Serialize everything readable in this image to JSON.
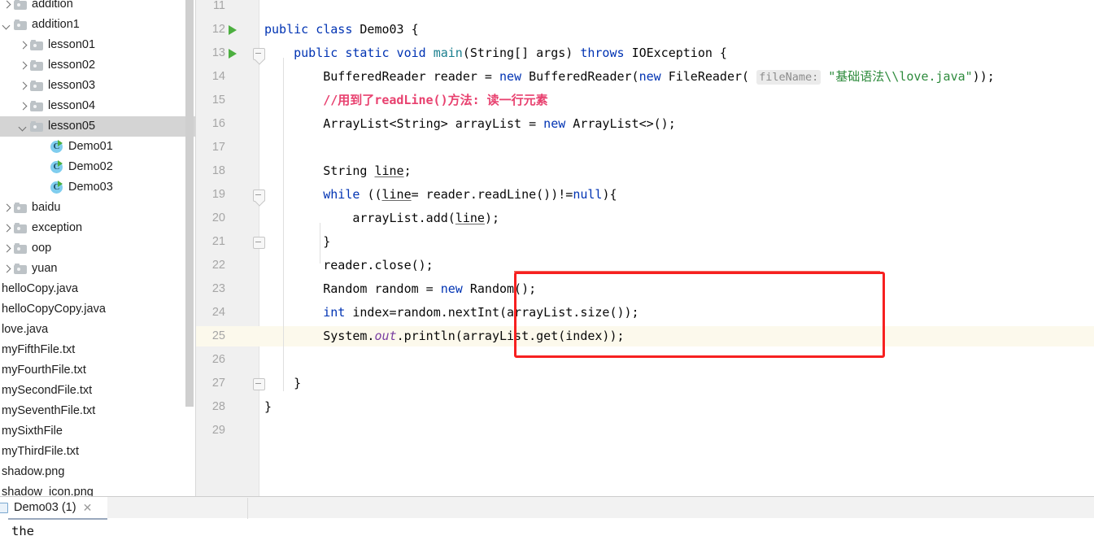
{
  "sidebar": {
    "tree": [
      {
        "label": "addition",
        "type": "folder",
        "arrow": "closed",
        "indent": 0,
        "selected": false,
        "clipped": true
      },
      {
        "label": "addition1",
        "type": "folder",
        "arrow": "open",
        "indent": 0,
        "selected": false
      },
      {
        "label": "lesson01",
        "type": "folder",
        "arrow": "closed",
        "indent": 1,
        "selected": false
      },
      {
        "label": "lesson02",
        "type": "folder",
        "arrow": "closed",
        "indent": 1,
        "selected": false
      },
      {
        "label": "lesson03",
        "type": "folder",
        "arrow": "closed",
        "indent": 1,
        "selected": false
      },
      {
        "label": "lesson04",
        "type": "folder",
        "arrow": "closed",
        "indent": 1,
        "selected": false
      },
      {
        "label": "lesson05",
        "type": "folder",
        "arrow": "open",
        "indent": 1,
        "selected": true
      },
      {
        "label": "Demo01",
        "type": "class",
        "indent": 2,
        "selected": false
      },
      {
        "label": "Demo02",
        "type": "class",
        "indent": 2,
        "selected": false
      },
      {
        "label": "Demo03",
        "type": "class",
        "indent": 2,
        "selected": false
      },
      {
        "label": "baidu",
        "type": "folder",
        "arrow": "closed",
        "indent": 0,
        "selected": false
      },
      {
        "label": "exception",
        "type": "folder",
        "arrow": "closed",
        "indent": 0,
        "selected": false
      },
      {
        "label": "oop",
        "type": "folder",
        "arrow": "closed",
        "indent": 0,
        "selected": false
      },
      {
        "label": "yuan",
        "type": "folder",
        "arrow": "closed",
        "indent": 0,
        "selected": false
      },
      {
        "label": "helloCopy.java",
        "type": "file",
        "indent": 0,
        "selected": false
      },
      {
        "label": "helloCopyCopy.java",
        "type": "file",
        "indent": 0,
        "selected": false
      },
      {
        "label": "love.java",
        "type": "file",
        "indent": 0,
        "selected": false
      },
      {
        "label": "myFifthFile.txt",
        "type": "file",
        "indent": 0,
        "selected": false
      },
      {
        "label": "myFourthFile.txt",
        "type": "file",
        "indent": 0,
        "selected": false
      },
      {
        "label": "mySecondFile.txt",
        "type": "file",
        "indent": 0,
        "selected": false
      },
      {
        "label": "mySeventhFile.txt",
        "type": "file",
        "indent": 0,
        "selected": false
      },
      {
        "label": "mySixthFile",
        "type": "file",
        "indent": 0,
        "selected": false
      },
      {
        "label": "myThirdFile.txt",
        "type": "file",
        "indent": 0,
        "selected": false
      },
      {
        "label": "shadow.png",
        "type": "file",
        "indent": 0,
        "selected": false
      },
      {
        "label": "shadow_icon.png",
        "type": "file",
        "indent": 0,
        "selected": false,
        "clipped": true
      }
    ]
  },
  "editor": {
    "first_line_number": 11,
    "current_line": 25,
    "lines": [
      {
        "n": 11,
        "run": false,
        "fold": null,
        "tokens": []
      },
      {
        "n": 12,
        "run": true,
        "fold": null,
        "tokens": [
          {
            "t": "public ",
            "c": "kw"
          },
          {
            "t": "class ",
            "c": "kw"
          },
          {
            "t": "Demo03 {",
            "c": ""
          }
        ],
        "indent": 0
      },
      {
        "n": 13,
        "run": true,
        "fold": "tip",
        "tokens": [
          {
            "t": "    ",
            "c": ""
          },
          {
            "t": "public static void ",
            "c": "kw"
          },
          {
            "t": "main",
            "c": "meth"
          },
          {
            "t": "(String[] args) ",
            "c": ""
          },
          {
            "t": "throws ",
            "c": "kw"
          },
          {
            "t": "IOException {",
            "c": ""
          }
        ],
        "indent": 1
      },
      {
        "n": 14,
        "run": false,
        "fold": null,
        "tokens": [
          {
            "t": "        BufferedReader reader = ",
            "c": ""
          },
          {
            "t": "new ",
            "c": "kw"
          },
          {
            "t": "BufferedReader(",
            "c": ""
          },
          {
            "t": "new ",
            "c": "kw"
          },
          {
            "t": "FileReader( ",
            "c": ""
          },
          {
            "t": "fileName:",
            "c": "hint"
          },
          {
            "t": " ",
            "c": ""
          },
          {
            "t": "\"基础语法\\\\love.java\"",
            "c": "str"
          },
          {
            "t": "));",
            "c": ""
          }
        ],
        "indent": 2
      },
      {
        "n": 15,
        "run": false,
        "fold": null,
        "tokens": [
          {
            "t": "        ",
            "c": ""
          },
          {
            "t": "//用到了readLine()方法: 读一行元素",
            "c": "cmt"
          }
        ],
        "indent": 2
      },
      {
        "n": 16,
        "run": false,
        "fold": null,
        "tokens": [
          {
            "t": "        ArrayList<String> arrayList = ",
            "c": ""
          },
          {
            "t": "new ",
            "c": "kw"
          },
          {
            "t": "ArrayList<>();",
            "c": ""
          }
        ],
        "indent": 2
      },
      {
        "n": 17,
        "run": false,
        "fold": null,
        "tokens": [],
        "indent": 2
      },
      {
        "n": 18,
        "run": false,
        "fold": null,
        "tokens": [
          {
            "t": "        String ",
            "c": ""
          },
          {
            "t": "line",
            "c": "lvar"
          },
          {
            "t": ";",
            "c": ""
          }
        ],
        "indent": 2
      },
      {
        "n": 19,
        "run": false,
        "fold": "tip",
        "tokens": [
          {
            "t": "        ",
            "c": ""
          },
          {
            "t": "while ",
            "c": "kw"
          },
          {
            "t": "((",
            "c": ""
          },
          {
            "t": "line",
            "c": "lvar"
          },
          {
            "t": "= reader.readLine())!=",
            "c": ""
          },
          {
            "t": "null",
            "c": "kw"
          },
          {
            "t": "){",
            "c": ""
          }
        ],
        "indent": 2
      },
      {
        "n": 20,
        "run": false,
        "fold": null,
        "tokens": [
          {
            "t": "            arrayList.add(",
            "c": ""
          },
          {
            "t": "line",
            "c": "lvar"
          },
          {
            "t": ");",
            "c": ""
          }
        ],
        "indent": 3
      },
      {
        "n": 21,
        "run": false,
        "fold": "plain",
        "tokens": [
          {
            "t": "        }",
            "c": ""
          }
        ],
        "indent": 2
      },
      {
        "n": 22,
        "run": false,
        "fold": null,
        "tokens": [
          {
            "t": "        reader.close();",
            "c": ""
          }
        ],
        "indent": 2
      },
      {
        "n": 23,
        "run": false,
        "fold": null,
        "tokens": [
          {
            "t": "        Random random = ",
            "c": ""
          },
          {
            "t": "new ",
            "c": "kw"
          },
          {
            "t": "Random();",
            "c": ""
          }
        ],
        "indent": 2
      },
      {
        "n": 24,
        "run": false,
        "fold": null,
        "tokens": [
          {
            "t": "        ",
            "c": ""
          },
          {
            "t": "int ",
            "c": "kw"
          },
          {
            "t": "index=random.nextInt(arrayList.size());",
            "c": ""
          }
        ],
        "indent": 2
      },
      {
        "n": 25,
        "run": false,
        "fold": null,
        "tokens": [
          {
            "t": "        System.",
            "c": ""
          },
          {
            "t": "out",
            "c": "stat"
          },
          {
            "t": ".println(arrayList.get(index));",
            "c": ""
          }
        ],
        "indent": 2
      },
      {
        "n": 26,
        "run": false,
        "fold": null,
        "tokens": [],
        "indent": 2
      },
      {
        "n": 27,
        "run": false,
        "fold": "plain",
        "tokens": [
          {
            "t": "    }",
            "c": ""
          }
        ],
        "indent": 1
      },
      {
        "n": 28,
        "run": false,
        "fold": null,
        "tokens": [
          {
            "t": "}",
            "c": ""
          }
        ],
        "indent": 0
      },
      {
        "n": 29,
        "run": false,
        "fold": null,
        "tokens": [],
        "indent": 0
      }
    ],
    "annotation": {
      "type": "red-rectangle",
      "color": "#f72020",
      "covers_lines": [
        23,
        24,
        25
      ]
    }
  },
  "bottom_panel": {
    "tab_label": "Demo03 (1)",
    "tab_close_glyph": "✕",
    "console_output": "the"
  },
  "colors": {
    "keyword": "#0033b3",
    "method": "#1a7f8e",
    "string": "#2e8b3d",
    "comment": "#e8416f",
    "static_field": "#7a3ea1",
    "current_line_bg": "#fcf9ec",
    "gutter_bg": "#f0f0f0",
    "selection_bg": "#d4d4d4",
    "annotation_red": "#f72020",
    "tab_underline": "#9aa8bd"
  }
}
